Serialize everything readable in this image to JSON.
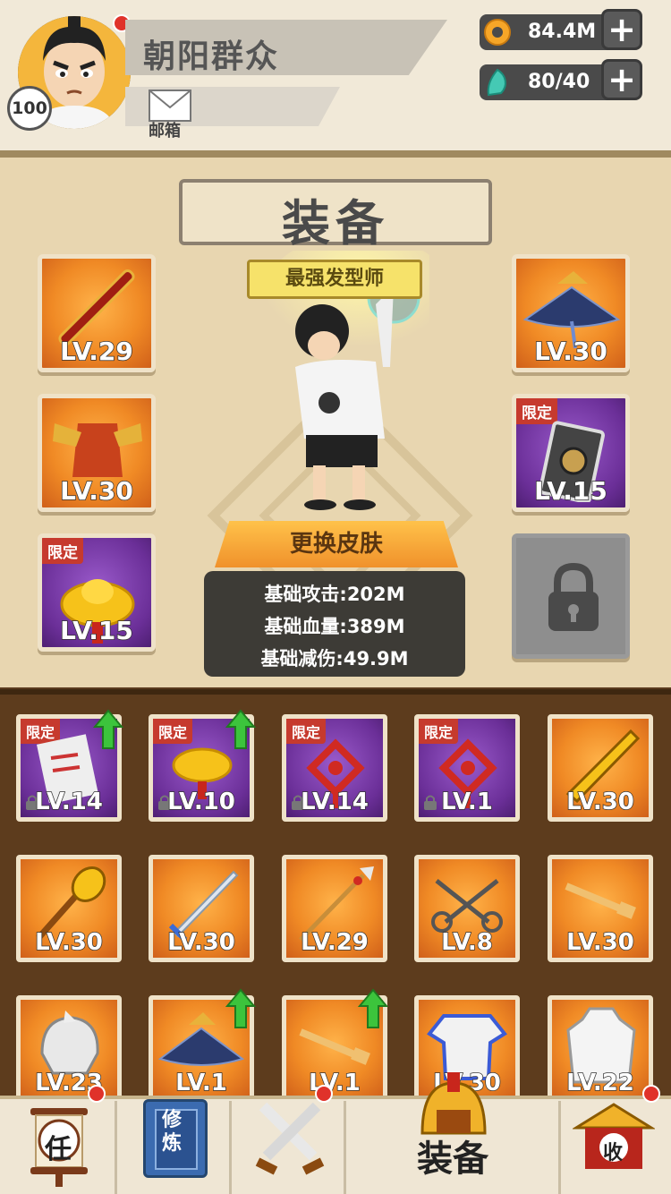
{
  "player": {
    "name": "朝阳群众",
    "level": "100"
  },
  "mail": {
    "label": "邮箱"
  },
  "resources": {
    "gold": "84.4M",
    "gems": "80/40"
  },
  "equip_panel": {
    "title": "装备",
    "character_title": "最强发型师",
    "change_skin_label": "更换皮肤",
    "stats": [
      "基础攻击:202M",
      "基础血量:389M",
      "基础减伤:49.9M"
    ],
    "left_slots": [
      {
        "item": "staff",
        "level": "LV.29",
        "rarity": "orange"
      },
      {
        "item": "armor",
        "level": "LV.30",
        "rarity": "orange"
      },
      {
        "item": "gold-ingot",
        "level": "LV.15",
        "rarity": "purple",
        "tag": "限定"
      }
    ],
    "right_slots": [
      {
        "item": "straw-hat",
        "level": "LV.30",
        "rarity": "orange"
      },
      {
        "item": "talisman-banner",
        "level": "LV.15",
        "rarity": "purple",
        "tag": "限定"
      },
      {
        "item": "locked-slot",
        "level": "",
        "rarity": "locked"
      }
    ]
  },
  "inventory": [
    {
      "item": "book",
      "level": "LV.14",
      "rarity": "purple",
      "tag": "限定",
      "locked": true,
      "upgrade": true
    },
    {
      "item": "gold-ingot",
      "level": "LV.10",
      "rarity": "purple",
      "tag": "限定",
      "locked": true,
      "upgrade": true
    },
    {
      "item": "chinese-knot",
      "level": "LV.14",
      "rarity": "purple",
      "tag": "限定",
      "locked": true,
      "upgrade": false
    },
    {
      "item": "chinese-knot",
      "level": "LV.1",
      "rarity": "purple",
      "tag": "限定",
      "locked": true,
      "upgrade": false
    },
    {
      "item": "broadsword",
      "level": "LV.30",
      "rarity": "orange"
    },
    {
      "item": "mace",
      "level": "LV.30",
      "rarity": "orange"
    },
    {
      "item": "sword",
      "level": "LV.30",
      "rarity": "orange"
    },
    {
      "item": "spear",
      "level": "LV.29",
      "rarity": "orange"
    },
    {
      "item": "scissors",
      "level": "LV.8",
      "rarity": "orange"
    },
    {
      "item": "key",
      "level": "LV.30",
      "rarity": "orange"
    },
    {
      "item": "helmet",
      "level": "LV.23",
      "rarity": "orange"
    },
    {
      "item": "straw-hat",
      "level": "LV.1",
      "rarity": "orange",
      "upgrade": true
    },
    {
      "item": "key",
      "level": "LV.1",
      "rarity": "orange",
      "upgrade": true
    },
    {
      "item": "robe",
      "level": "LV.30",
      "rarity": "orange"
    },
    {
      "item": "hoodie",
      "level": "LV.22",
      "rarity": "orange"
    }
  ],
  "bottom_nav": {
    "task_label": "任",
    "cultivate_label": "修炼",
    "equip_label": "装备",
    "collect_label": "收"
  },
  "colors": {
    "orange_rarity": "#f08a25",
    "purple_rarity": "#6b2f98",
    "limit_tag": "#c63a2e",
    "red_dot": "#e0322a",
    "upgrade_arrow": "#3cc43c"
  }
}
